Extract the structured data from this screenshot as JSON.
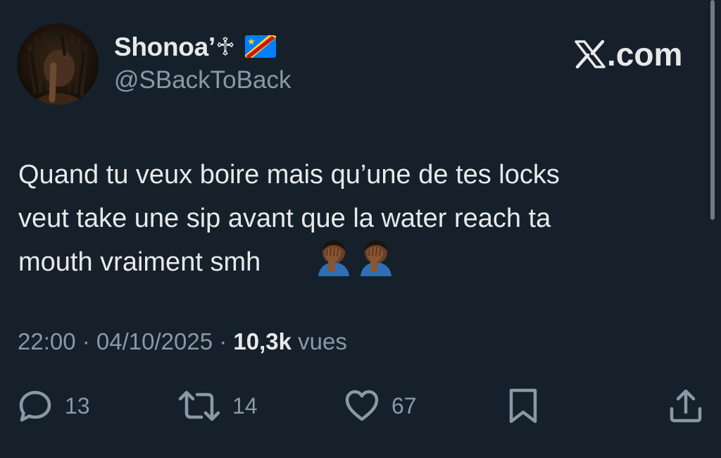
{
  "author": {
    "display_name": "Shonoa’♱",
    "flag": "flag-cd",
    "handle": "@SBackToBack",
    "avatar": "profile-photo"
  },
  "watermark": {
    "label": ".com",
    "logo": "x-logo-icon"
  },
  "tweet": {
    "text": "Quand tu veux boire mais qu’une de tes locks\nveut take une sip avant que la water reach ta\nmouth vraiment smh",
    "emojis": [
      "face-palm-icon",
      "face-palm-icon"
    ]
  },
  "meta": {
    "time": "22:00",
    "separator": " · ",
    "date": "04/10/2025",
    "views": "10,3k",
    "views_label": " vues"
  },
  "actions": {
    "replies": "13",
    "reposts": "14",
    "likes": "67"
  },
  "colors": {
    "background": "#15202b",
    "primary_text": "#e7e9ea",
    "secondary_text": "#8b98a5"
  }
}
